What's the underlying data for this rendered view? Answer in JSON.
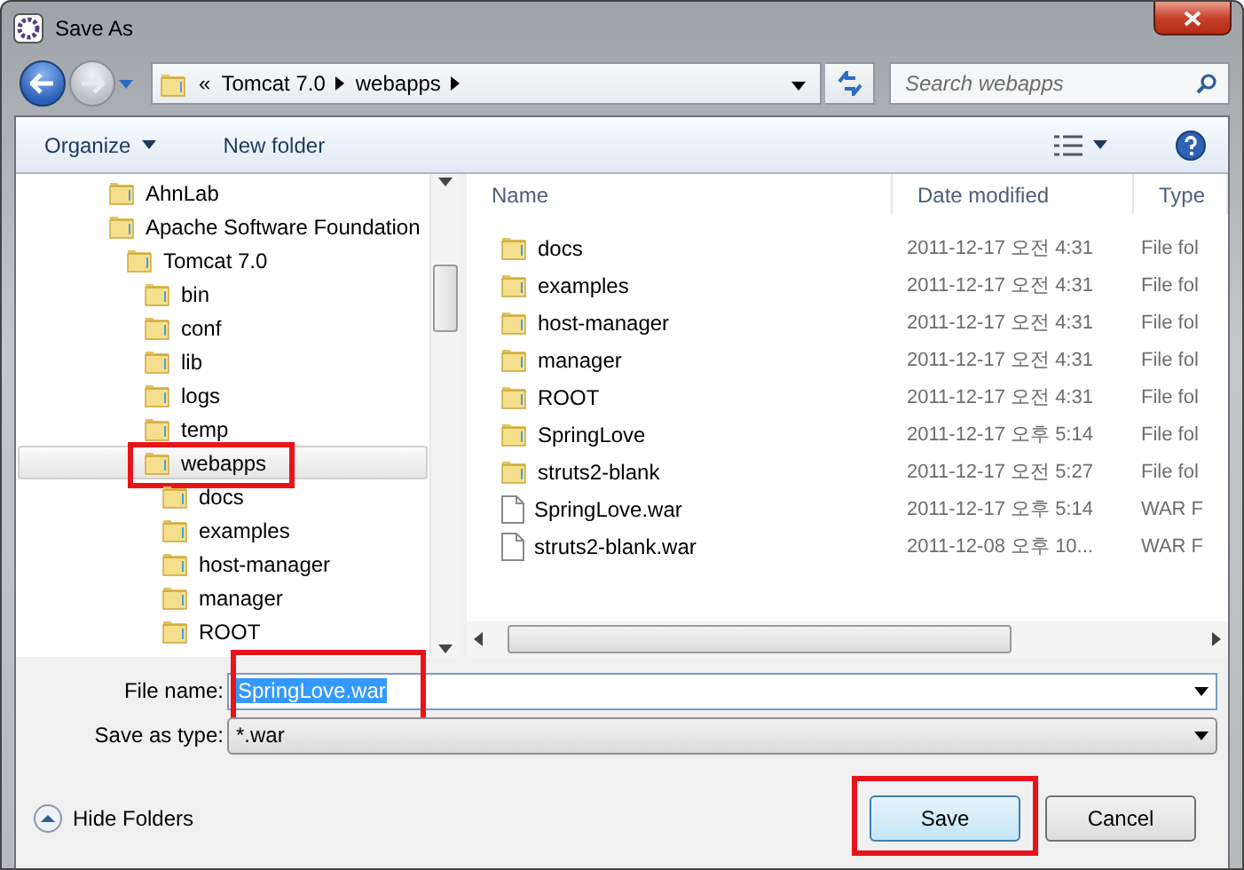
{
  "window": {
    "title": "Save As"
  },
  "address": {
    "overflow_mark": "«",
    "path": [
      "Tomcat 7.0",
      "webapps"
    ]
  },
  "search": {
    "placeholder": "Search webapps"
  },
  "toolbar": {
    "organize": "Organize",
    "new_folder": "New folder"
  },
  "tree": {
    "items": [
      {
        "label": "AhnLab",
        "selected": false,
        "annotated": false
      },
      {
        "label": "Apache Software Foundation",
        "selected": false,
        "annotated": false,
        "children": [
          {
            "label": "Tomcat 7.0",
            "selected": false,
            "annotated": false,
            "children": [
              {
                "label": "bin",
                "selected": false,
                "annotated": false
              },
              {
                "label": "conf",
                "selected": false,
                "annotated": false
              },
              {
                "label": "lib",
                "selected": false,
                "annotated": false
              },
              {
                "label": "logs",
                "selected": false,
                "annotated": false
              },
              {
                "label": "temp",
                "selected": false,
                "annotated": false
              },
              {
                "label": "webapps",
                "selected": true,
                "annotated": true,
                "children": [
                  {
                    "label": "docs",
                    "selected": false,
                    "annotated": false
                  },
                  {
                    "label": "examples",
                    "selected": false,
                    "annotated": false
                  },
                  {
                    "label": "host-manager",
                    "selected": false,
                    "annotated": false
                  },
                  {
                    "label": "manager",
                    "selected": false,
                    "annotated": false
                  },
                  {
                    "label": "ROOT",
                    "selected": false,
                    "annotated": false
                  }
                ]
              }
            ]
          }
        ]
      }
    ]
  },
  "files": {
    "columns": [
      "Name",
      "Date modified",
      "Type"
    ],
    "rows": [
      {
        "kind": "folder",
        "name": "docs",
        "date": "2011-12-17 오전 4:31",
        "type": "File fol"
      },
      {
        "kind": "folder",
        "name": "examples",
        "date": "2011-12-17 오전 4:31",
        "type": "File fol"
      },
      {
        "kind": "folder",
        "name": "host-manager",
        "date": "2011-12-17 오전 4:31",
        "type": "File fol"
      },
      {
        "kind": "folder",
        "name": "manager",
        "date": "2011-12-17 오전 4:31",
        "type": "File fol"
      },
      {
        "kind": "folder",
        "name": "ROOT",
        "date": "2011-12-17 오전 4:31",
        "type": "File fol"
      },
      {
        "kind": "folder",
        "name": "SpringLove",
        "date": "2011-12-17 오후 5:14",
        "type": "File fol"
      },
      {
        "kind": "folder",
        "name": "struts2-blank",
        "date": "2011-12-17 오전 5:27",
        "type": "File fol"
      },
      {
        "kind": "file",
        "name": "SpringLove.war",
        "date": "2011-12-17 오후 5:14",
        "type": "WAR F"
      },
      {
        "kind": "file",
        "name": "struts2-blank.war",
        "date": "2011-12-08 오후 10...",
        "type": "WAR F"
      }
    ]
  },
  "file_name": {
    "label": "File name:",
    "value": "SpringLove.war",
    "annotated": true
  },
  "save_type": {
    "label": "Save as type:",
    "value": "*.war"
  },
  "hide_folders": "Hide Folders",
  "buttons": [
    {
      "label": "Save",
      "default": true,
      "annotated": true
    },
    {
      "label": "Cancel",
      "default": false,
      "annotated": false
    }
  ]
}
